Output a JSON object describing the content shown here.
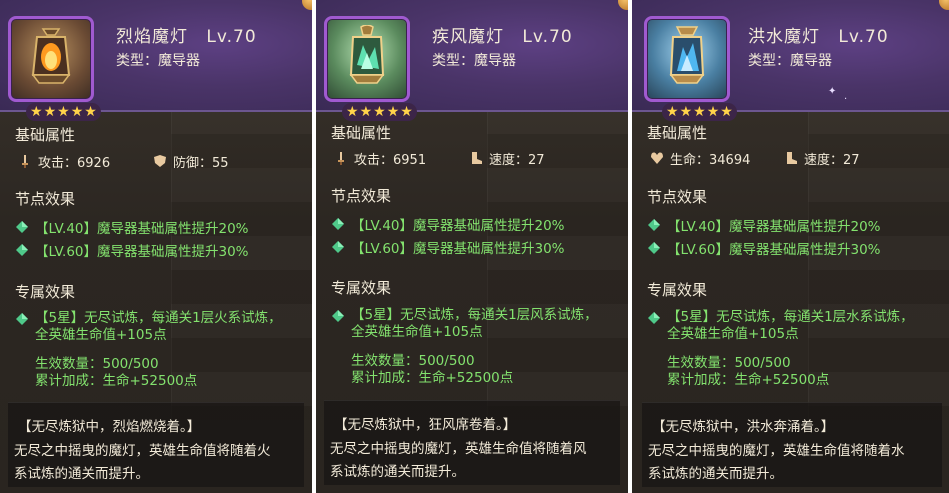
{
  "cards": [
    {
      "name": "烈焰魔灯",
      "level": "Lv.70",
      "type_text": "类型：魔导器",
      "stars": 5,
      "icon": "fire-lantern-icon",
      "base_title": "基础属性",
      "attr1": {
        "icon": "sword-icon",
        "label": "攻击：6926"
      },
      "attr2": {
        "icon": "shield-icon",
        "label": "防御：55"
      },
      "node_title": "节点效果",
      "node1": "【LV.40】魔导器基础属性提升20%",
      "node2": "【LV.60】魔导器基础属性提升30%",
      "excl_title": "专属效果",
      "excl_line1": "【5星】无尽试炼，每通关1层火系试炼，",
      "excl_line2": "全英雄生命值+105点",
      "count_line1": "生效数量：500/500",
      "count_line2": "累计加成：生命+52500点",
      "lore_title": "【无尽炼狱中，烈焰燃烧着。】",
      "lore_line1": "无尽之中摇曳的魔灯，英雄生命值将随着火",
      "lore_line2": "系试炼的通关而提升。"
    },
    {
      "name": "疾风魔灯",
      "level": "Lv.70",
      "type_text": "类型：魔导器",
      "stars": 5,
      "icon": "wind-lantern-icon",
      "base_title": "基础属性",
      "attr1": {
        "icon": "sword-icon",
        "label": "攻击：6951"
      },
      "attr2": {
        "icon": "boot-icon",
        "label": "速度：27"
      },
      "node_title": "节点效果",
      "node1": "【LV.40】魔导器基础属性提升20%",
      "node2": "【LV.60】魔导器基础属性提升30%",
      "excl_title": "专属效果",
      "excl_line1": "【5星】无尽试炼，每通关1层风系试炼，",
      "excl_line2": "全英雄生命值+105点",
      "count_line1": "生效数量：500/500",
      "count_line2": "累计加成：生命+52500点",
      "lore_title": "【无尽炼狱中，狂风席卷着。】",
      "lore_line1": "无尽之中摇曳的魔灯，英雄生命值将随着风",
      "lore_line2": "系试炼的通关而提升。"
    },
    {
      "name": "洪水魔灯",
      "level": "Lv.70",
      "type_text": "类型：魔导器",
      "stars": 5,
      "icon": "water-lantern-icon",
      "base_title": "基础属性",
      "attr1": {
        "icon": "heart-icon",
        "label": "生命：34694"
      },
      "attr2": {
        "icon": "boot-icon",
        "label": "速度：27"
      },
      "node_title": "节点效果",
      "node1": "【LV.40】魔导器基础属性提升20%",
      "node2": "【LV.60】魔导器基础属性提升30%",
      "excl_title": "专属效果",
      "excl_line1": "【5星】无尽试炼，每通关1层水系试炼，",
      "excl_line2": "全英雄生命值+105点",
      "count_line1": "生效数量：500/500",
      "count_line2": "累计加成：生命+52500点",
      "lore_title": "【无尽炼狱中，洪水奔涌着。】",
      "lore_line1": "无尽之中摇曳的魔灯，英雄生命值将随着水",
      "lore_line2": "系试炼的通关而提升。"
    }
  ],
  "colors": {
    "effect_green": "#83e26e",
    "text_cream": "#f2ead8",
    "header_purple": "#4a3468",
    "star_gold": "#ffd34a",
    "panel_brown": "#2c2722"
  }
}
